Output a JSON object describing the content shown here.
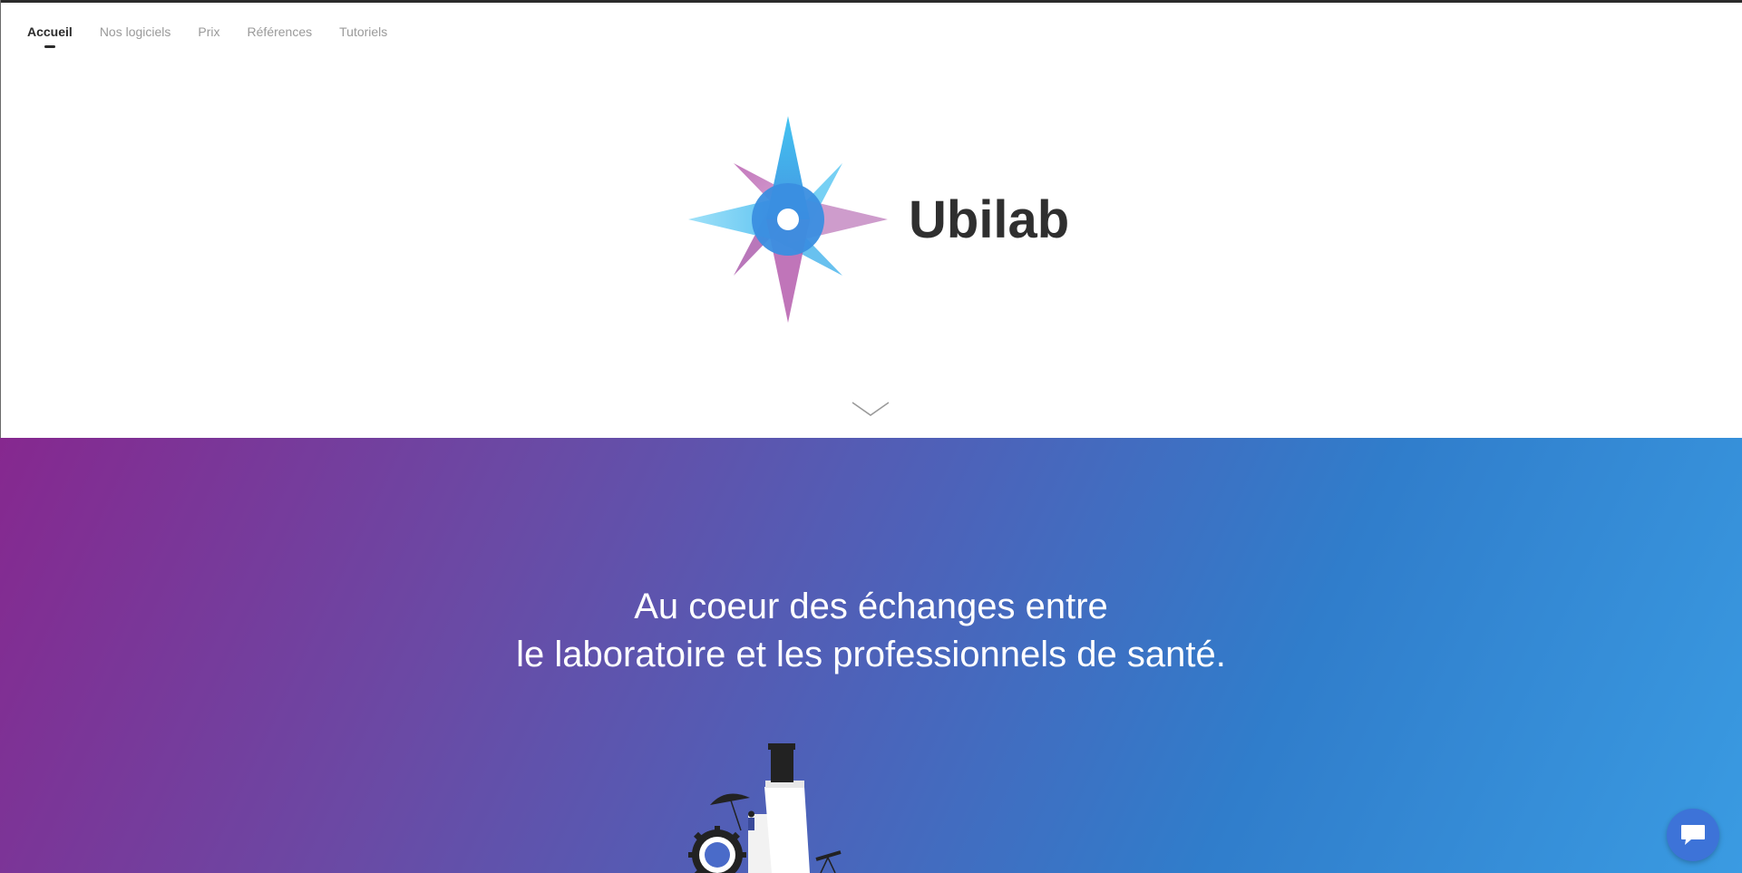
{
  "nav": {
    "items": [
      {
        "label": "Accueil",
        "active": true
      },
      {
        "label": "Nos logiciels",
        "active": false
      },
      {
        "label": "Prix",
        "active": false
      },
      {
        "label": "Références",
        "active": false
      },
      {
        "label": "Tutoriels",
        "active": false
      }
    ]
  },
  "hero": {
    "brand_name": "Ubilab",
    "logo_icon": "compass-star-logo",
    "scroll_icon": "chevron-down-icon"
  },
  "band": {
    "tagline_line1": "Au coeur des échanges entre",
    "tagline_line2": "le laboratoire et les professionnels de santé.",
    "illustration_icon": "microscope-illustration",
    "gradient_colors": [
      "#86288f",
      "#3a9be2"
    ]
  },
  "chat": {
    "icon": "chat-bubble-icon",
    "color": "#3d73d8"
  },
  "colors": {
    "nav_active": "#2b2b2b",
    "nav_inactive": "#9a9a9a",
    "brand_text": "#2f2f2f"
  }
}
